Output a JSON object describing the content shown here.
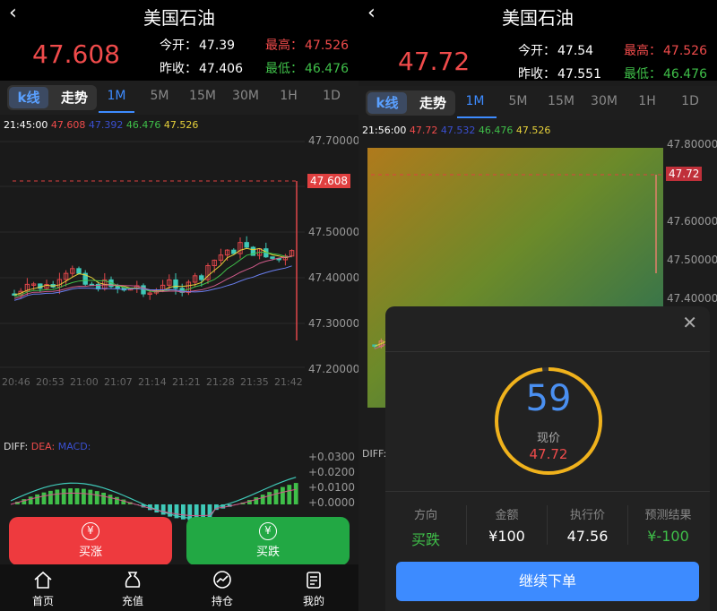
{
  "left": {
    "title": "美国石油",
    "price": "47.608",
    "open_label": "今开：",
    "open": "47.39",
    "prev_label": "昨收：",
    "prev": "47.406",
    "high_label": "最高：",
    "high": "47.526",
    "low_label": "最低：",
    "low": "46.476",
    "seg_on": "k线",
    "seg_off": "走势",
    "timeframes": [
      "1M",
      "5M",
      "15M",
      "30M",
      "1H",
      "1D"
    ],
    "ma_time": "21:45:00",
    "ma_values": [
      "47.608",
      "47.392",
      "46.476",
      "47.526"
    ],
    "y_labels": [
      "47.70000",
      "47.60000",
      "47.50000",
      "47.40000",
      "47.30000",
      "47.20000"
    ],
    "price_tag": "47.608",
    "x_labels": [
      "20:46",
      "20:53",
      "21:00",
      "21:07",
      "21:14",
      "21:21",
      "21:28",
      "21:35",
      "21:42"
    ],
    "macd_labels": [
      "DIFF:",
      "DEA:",
      "MACD:"
    ],
    "macd_y": [
      "+0.0300",
      "+0.0200",
      "+0.0100",
      "+0.0000"
    ],
    "buy_up": "买涨",
    "buy_down": "买跌",
    "nav": [
      "首页",
      "充值",
      "持仓",
      "我的"
    ]
  },
  "right": {
    "title": "美国石油",
    "price": "47.72",
    "open_label": "今开：",
    "open": "47.54",
    "prev_label": "昨收：",
    "prev": "47.551",
    "high_label": "最高：",
    "high": "47.526",
    "low_label": "最低：",
    "low": "46.476",
    "seg_on": "k线",
    "seg_off": "走势",
    "timeframes": [
      "1M",
      "5M",
      "15M",
      "30M",
      "1H",
      "1D"
    ],
    "ma_time": "21:56:00",
    "ma_values": [
      "47.72",
      "47.532",
      "46.476",
      "47.526"
    ],
    "y_labels": [
      "47.80000",
      "47.70000",
      "47.60000",
      "47.50000",
      "47.40000"
    ],
    "price_tag": "47.72",
    "macd_label": "DIFF:"
  },
  "modal": {
    "countdown": "59",
    "current_label": "现价",
    "current_price": "47.72",
    "countdown_fraction": 0.98,
    "cols": [
      {
        "h": "方向",
        "v": "买跌"
      },
      {
        "h": "金额",
        "v": "¥100"
      },
      {
        "h": "执行价",
        "v": "47.56"
      },
      {
        "h": "预测结果",
        "v": "¥-100"
      }
    ],
    "cta": "继续下单"
  },
  "colors": {
    "up": "#f04b4b",
    "down": "#3fbf49",
    "candle_up": "#e0464a",
    "candle_down": "#3fc9b8",
    "accent": "#3d8bff"
  }
}
